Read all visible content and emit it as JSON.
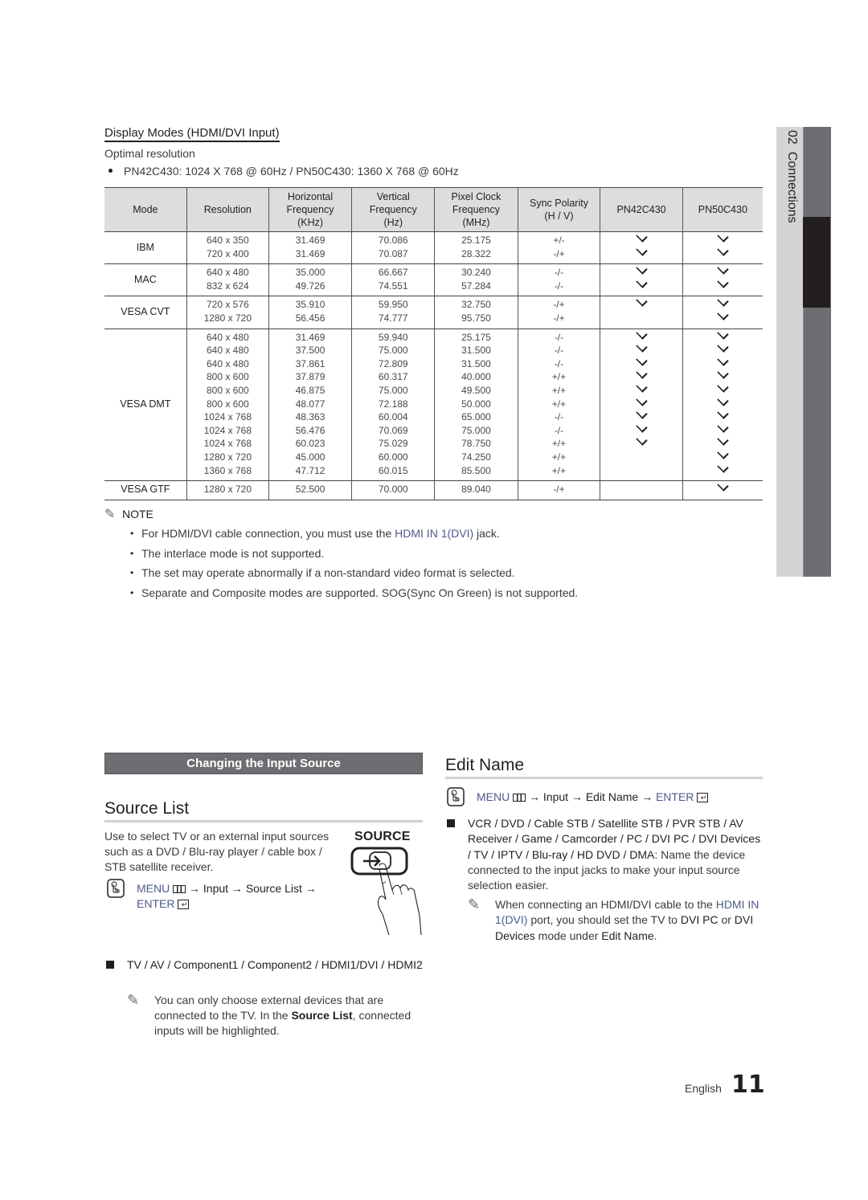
{
  "display_modes": {
    "title": "Display Modes (HDMI/DVI Input)",
    "optimal_label": "Optimal resolution",
    "optimal_bullet": "PN42C430: 1024 X 768 @ 60Hz / PN50C430: 1360 X 768 @ 60Hz"
  },
  "table": {
    "headers": {
      "mode": "Mode",
      "resolution": "Resolution",
      "hfreq": [
        "Horizontal",
        "Frequency",
        "(KHz)"
      ],
      "vfreq": [
        "Vertical",
        "Frequency",
        "(Hz)"
      ],
      "pclock": [
        "Pixel Clock",
        "Frequency",
        "(MHz)"
      ],
      "sync": [
        "Sync Polarity",
        "(H / V)"
      ],
      "pn42": "PN42C430",
      "pn50": "PN50C430"
    },
    "check_icon": "check-icon",
    "groups": [
      {
        "mode": "IBM",
        "rows": [
          {
            "res": "640 x 350",
            "h": "31.469",
            "v": "70.086",
            "p": "25.175",
            "s": "+/-",
            "pn42": true,
            "pn50": true
          },
          {
            "res": "720 x 400",
            "h": "31.469",
            "v": "70.087",
            "p": "28.322",
            "s": "-/+",
            "pn42": true,
            "pn50": true
          }
        ]
      },
      {
        "mode": "MAC",
        "rows": [
          {
            "res": "640 x 480",
            "h": "35.000",
            "v": "66.667",
            "p": "30.240",
            "s": "-/-",
            "pn42": true,
            "pn50": true
          },
          {
            "res": "832 x 624",
            "h": "49.726",
            "v": "74.551",
            "p": "57.284",
            "s": "-/-",
            "pn42": true,
            "pn50": true
          }
        ]
      },
      {
        "mode": "VESA CVT",
        "rows": [
          {
            "res": "720 x 576",
            "h": "35.910",
            "v": "59.950",
            "p": "32.750",
            "s": "-/+",
            "pn42": true,
            "pn50": true
          },
          {
            "res": "1280 x 720",
            "h": "56.456",
            "v": "74.777",
            "p": "95.750",
            "s": "-/+",
            "pn42": false,
            "pn50": true
          }
        ]
      },
      {
        "mode": "VESA DMT",
        "rows": [
          {
            "res": "640 x 480",
            "h": "31.469",
            "v": "59.940",
            "p": "25.175",
            "s": "-/-",
            "pn42": true,
            "pn50": true
          },
          {
            "res": "640 x 480",
            "h": "37.500",
            "v": "75.000",
            "p": "31.500",
            "s": "-/-",
            "pn42": true,
            "pn50": true
          },
          {
            "res": "640 x 480",
            "h": "37.861",
            "v": "72.809",
            "p": "31.500",
            "s": "-/-",
            "pn42": true,
            "pn50": true
          },
          {
            "res": "800 x 600",
            "h": "37.879",
            "v": "60.317",
            "p": "40.000",
            "s": "+/+",
            "pn42": true,
            "pn50": true
          },
          {
            "res": "800 x 600",
            "h": "46.875",
            "v": "75.000",
            "p": "49.500",
            "s": "+/+",
            "pn42": true,
            "pn50": true
          },
          {
            "res": "800 x 600",
            "h": "48.077",
            "v": "72.188",
            "p": "50.000",
            "s": "+/+",
            "pn42": true,
            "pn50": true
          },
          {
            "res": "1024 x 768",
            "h": "48.363",
            "v": "60.004",
            "p": "65.000",
            "s": "-/-",
            "pn42": true,
            "pn50": true
          },
          {
            "res": "1024 x 768",
            "h": "56.476",
            "v": "70.069",
            "p": "75.000",
            "s": "-/-",
            "pn42": true,
            "pn50": true
          },
          {
            "res": "1024 x 768",
            "h": "60.023",
            "v": "75.029",
            "p": "78.750",
            "s": "+/+",
            "pn42": true,
            "pn50": true
          },
          {
            "res": "1280 x 720",
            "h": "45.000",
            "v": "60.000",
            "p": "74.250",
            "s": "+/+",
            "pn42": false,
            "pn50": true
          },
          {
            "res": "1360 x 768",
            "h": "47.712",
            "v": "60.015",
            "p": "85.500",
            "s": "+/+",
            "pn42": false,
            "pn50": true
          }
        ]
      },
      {
        "mode": "VESA GTF",
        "rows": [
          {
            "res": "1280 x 720",
            "h": "52.500",
            "v": "70.000",
            "p": "89.040",
            "s": "-/+",
            "pn42": false,
            "pn50": true
          }
        ]
      }
    ]
  },
  "note": {
    "icon": "pencil-note-icon",
    "label": "NOTE",
    "items": [
      {
        "before": "For HDMI/DVI cable connection, you must use the ",
        "hl": "HDMI IN 1(DVI)",
        "after": " jack."
      },
      {
        "before": "The interlace mode is not supported.",
        "hl": "",
        "after": ""
      },
      {
        "before": "The set may operate abnormally if a non-standard video format is selected.",
        "hl": "",
        "after": ""
      },
      {
        "before": "Separate and Composite modes are supported. SOG(Sync On Green) is not supported.",
        "hl": "",
        "after": ""
      }
    ]
  },
  "side_tab": {
    "chapter": "02",
    "label": "Connections"
  },
  "changing_input": {
    "header": "Changing the Input Source"
  },
  "source_list": {
    "title": "Source List",
    "description": "Use to select TV or an external input sources such as a DVD / Blu-ray player / cable box / STB satellite receiver.",
    "button_label": "SOURCE",
    "menu": {
      "menu_kw": "MENU",
      "arrow1": " → Input → Source List → ",
      "enter_kw": "ENTER"
    },
    "bullet": "TV / AV / Component1 / Component2 / HDMI1/DVI / HDMI2",
    "note": {
      "before": "You can only choose external devices that are connected to the TV. In the ",
      "bold": "Source List",
      "after": ", connected inputs will be highlighted."
    }
  },
  "edit_name": {
    "title": "Edit Name",
    "menu": {
      "menu_kw": "MENU",
      "path": " → Input → Edit Name → ",
      "enter_kw": "ENTER"
    },
    "bullet_bold": "VCR / DVD / Cable STB / Satellite STB / PVR STB / AV Receiver / Game / Camcorder / PC / DVI PC / DVI Devices / TV / IPTV / Blu-ray / HD DVD / DMA",
    "bullet_rest": ": Name the device connected to the input jacks to make your input source selection easier.",
    "note": {
      "p1": "When connecting an HDMI/DVI cable to the ",
      "hl": "HDMI IN 1(DVI)",
      "p2": " port, you should set the TV to ",
      "b1": "DVI PC",
      "p3": " or ",
      "b2": "DVI Devices",
      "p4": " mode under ",
      "b3": "Edit Name",
      "p5": "."
    }
  },
  "footer": {
    "language": "English",
    "page_number": "11"
  }
}
